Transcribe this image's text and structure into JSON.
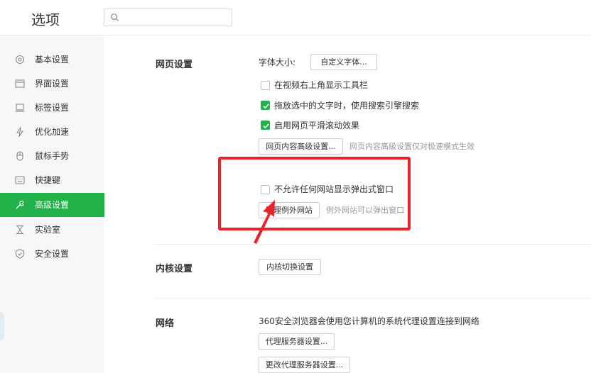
{
  "header": {
    "title": "选项",
    "search_placeholder": ""
  },
  "sidebar": {
    "items": [
      {
        "label": "基本设置",
        "icon": "gear-icon"
      },
      {
        "label": "界面设置",
        "icon": "window-icon"
      },
      {
        "label": "标签设置",
        "icon": "tab-icon"
      },
      {
        "label": "优化加速",
        "icon": "lightning-icon"
      },
      {
        "label": "鼠标手势",
        "icon": "mouse-icon"
      },
      {
        "label": "快捷键",
        "icon": "keyboard-icon"
      },
      {
        "label": "高级设置",
        "icon": "advanced-icon",
        "active": true
      },
      {
        "label": "实验室",
        "icon": "flask-icon"
      },
      {
        "label": "安全设置",
        "icon": "shield-icon"
      }
    ]
  },
  "webpage": {
    "section_label": "网页设置",
    "font_size_label": "字体大小:",
    "custom_font_button": "自定义字体...",
    "options": [
      {
        "label": "在视频右上角显示工具栏",
        "checked": false
      },
      {
        "label": "拖放选中的文字时，使用搜索引擎搜索",
        "checked": true
      },
      {
        "label": "启用网页平滑滚动效果",
        "checked": true
      }
    ],
    "advanced_button": "网页内容高级设置...",
    "advanced_hint": "网页内容高级设置仅对极速模式生效",
    "popup_option": {
      "label": "不允许任何网站显示弹出式窗口",
      "checked": false
    },
    "exception_button": "管理例外网站",
    "exception_hint": "例外网站可以弹出窗口"
  },
  "kernel": {
    "section_label": "内核设置",
    "switch_button": "内核切换设置"
  },
  "network": {
    "section_label": "网络",
    "description": "360安全浏览器会使用您计算机的系统代理设置连接到网络",
    "proxy_button": "代理服务器设置...",
    "change_proxy_button": "更改代理服务器设置..."
  },
  "colors": {
    "accent": "#21b24a",
    "highlight": "#e8232a"
  }
}
